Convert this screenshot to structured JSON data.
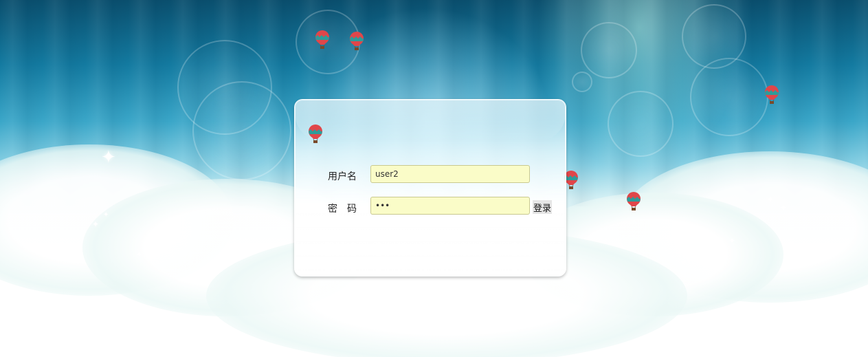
{
  "login": {
    "username_label": "用户名",
    "username_value": "user2",
    "password_label": "密　码",
    "password_value": "•••",
    "submit_label": "登录"
  },
  "colors": {
    "input_bg": "#fafcc8",
    "sky_top": "#0a4f6e",
    "balloon_red": "#e0464a",
    "balloon_teal": "#2e9c9a"
  },
  "icons": {
    "balloon": "hot-air-balloon-icon"
  }
}
